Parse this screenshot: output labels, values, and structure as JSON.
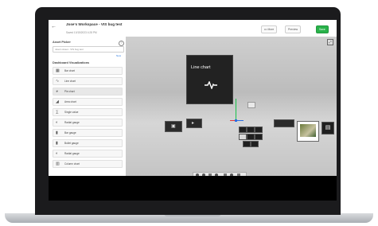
{
  "header": {
    "title": "Jose's Workspace - VIS bug test",
    "subtitle": "Saved 10/15/2023 4:28 PM",
    "buttons": {
      "more": "••• More",
      "preview": "Preview",
      "save": "Save"
    }
  },
  "sidebar": {
    "asset_picker_heading": "Asset Picker",
    "search_placeholder": "Search",
    "search_value": "Jose's Asset - VIS bug test",
    "new_link": "New",
    "dashboard_heading": "Dashboard Visualizations",
    "items": [
      {
        "label": "Bar chart",
        "icon": "bar-chart-icon"
      },
      {
        "label": "Line chart",
        "icon": "line-chart-icon"
      },
      {
        "label": "Pie chart",
        "icon": "pie-chart-icon"
      },
      {
        "label": "Area chart",
        "icon": "area-chart-icon"
      },
      {
        "label": "Single value",
        "icon": "single-value-icon"
      },
      {
        "label": "Radial gauge",
        "icon": "radial-gauge-icon"
      },
      {
        "label": "Bar gauge",
        "icon": "bar-gauge-icon"
      },
      {
        "label": "Bullet gauge",
        "icon": "bullet-gauge-icon"
      },
      {
        "label": "Radial gauge",
        "icon": "radial-gauge-icon"
      },
      {
        "label": "Column chart",
        "icon": "column-chart-icon"
      }
    ],
    "active_index": 2
  },
  "canvas": {
    "panel_title": "Line chart",
    "panel_icon": "pulse-icon",
    "accent_green": "#29b24a",
    "axis_colors": {
      "x": "#e23b3b",
      "y": "#18c24a",
      "z": "#2a6de2"
    }
  }
}
